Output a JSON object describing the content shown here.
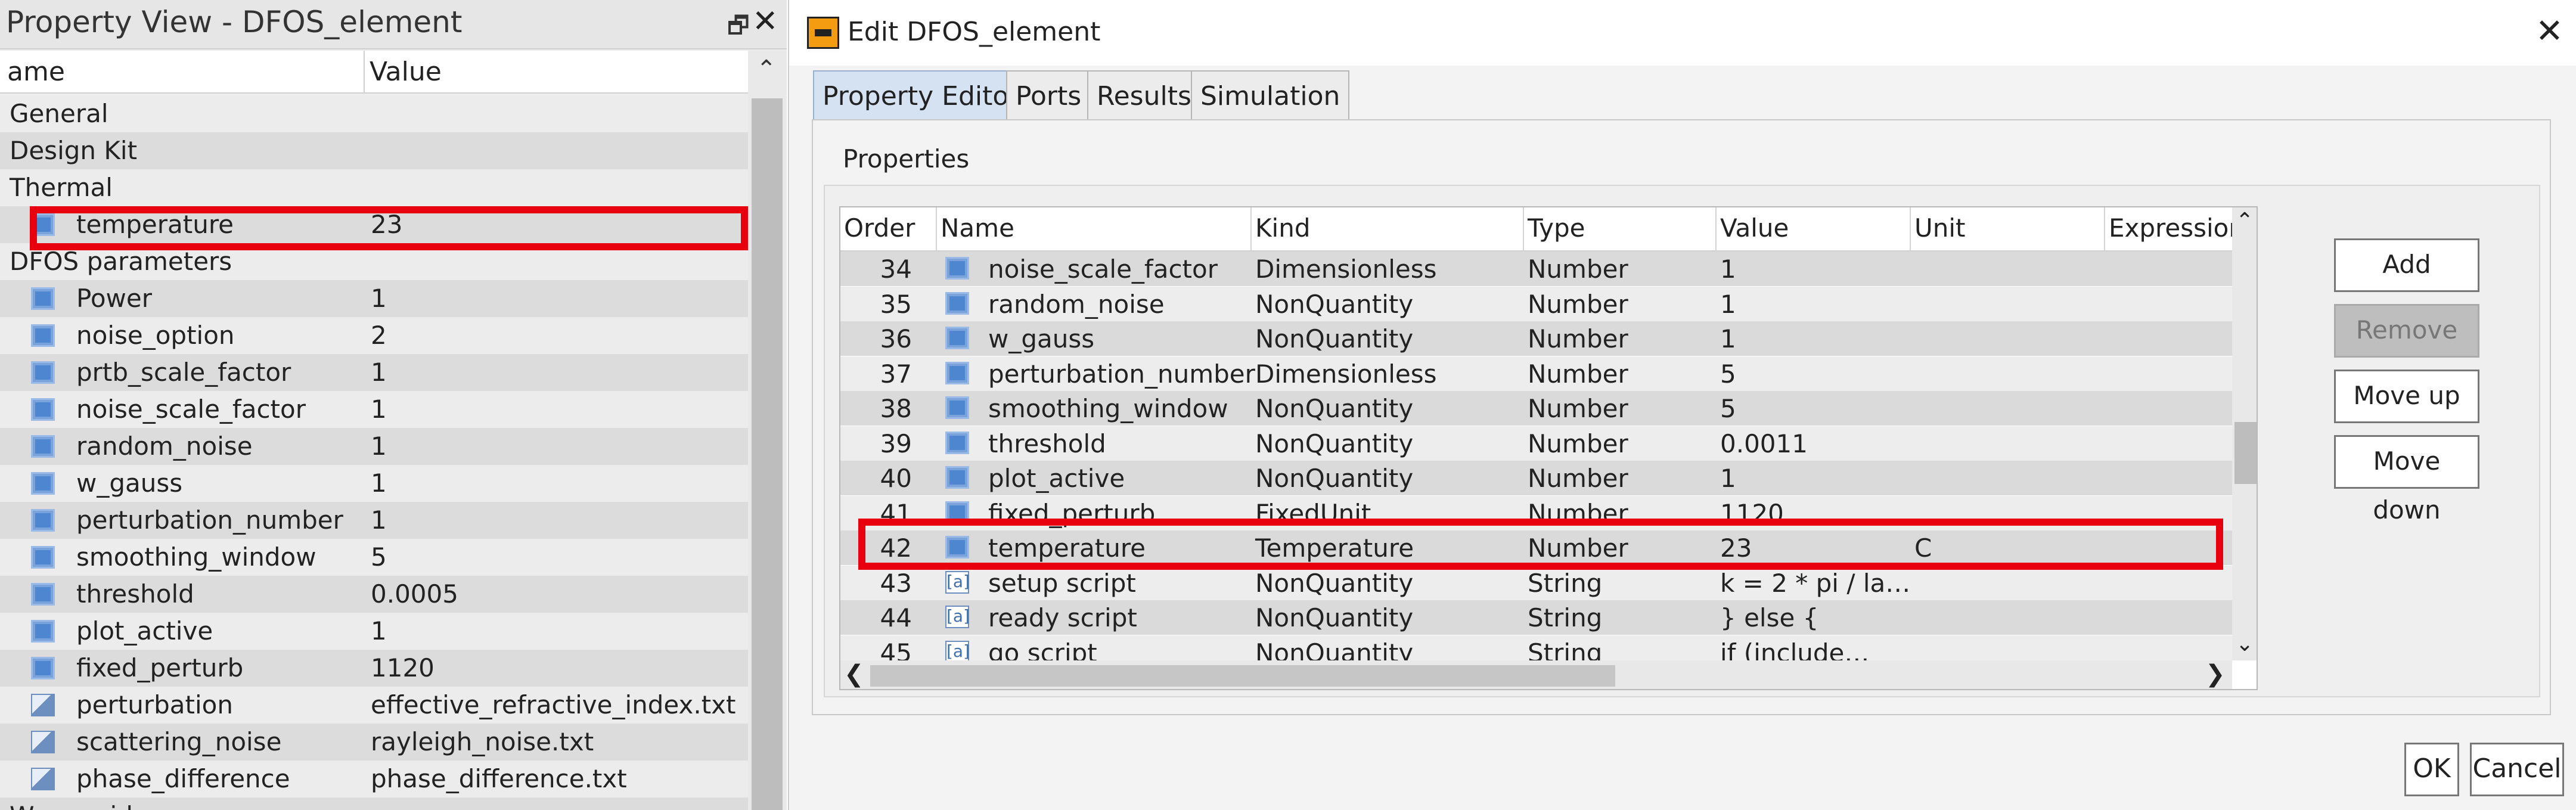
{
  "property_view": {
    "title": "Property View - DFOS_element",
    "restore_glyph": "🗗",
    "close_glyph": "✕",
    "col_name": "ame",
    "col_value": "Value",
    "rows": [
      {
        "name": "General",
        "value": "",
        "kind": "group"
      },
      {
        "name": "Design Kit",
        "value": "",
        "kind": "group"
      },
      {
        "name": "Thermal",
        "value": "",
        "kind": "group"
      },
      {
        "name": "temperature",
        "value": "23",
        "kind": "prop"
      },
      {
        "name": "DFOS parameters",
        "value": "",
        "kind": "group"
      },
      {
        "name": "Power",
        "value": "1",
        "kind": "prop"
      },
      {
        "name": "noise_option",
        "value": "2",
        "kind": "prop"
      },
      {
        "name": "prtb_scale_factor",
        "value": "1",
        "kind": "prop"
      },
      {
        "name": "noise_scale_factor",
        "value": "1",
        "kind": "prop"
      },
      {
        "name": "random_noise",
        "value": "1",
        "kind": "prop"
      },
      {
        "name": "w_gauss",
        "value": "1",
        "kind": "prop"
      },
      {
        "name": "perturbation_number",
        "value": "1",
        "kind": "prop"
      },
      {
        "name": "smoothing_window",
        "value": "5",
        "kind": "prop"
      },
      {
        "name": "threshold",
        "value": "0.0005",
        "kind": "prop"
      },
      {
        "name": "plot_active",
        "value": "1",
        "kind": "prop"
      },
      {
        "name": "fixed_perturb",
        "value": "1120",
        "kind": "prop"
      },
      {
        "name": "perturbation",
        "value": "effective_refractive_index.txt",
        "kind": "file"
      },
      {
        "name": "scattering_noise",
        "value": "rayleigh_noise.txt",
        "kind": "file"
      },
      {
        "name": "phase_difference",
        "value": "phase_difference.txt",
        "kind": "file"
      },
      {
        "name": "Waveguide",
        "value": "",
        "kind": "group"
      }
    ]
  },
  "dialog": {
    "title": "Edit DFOS_element",
    "close_glyph": "✕",
    "tabs": [
      "Property Editor",
      "Ports",
      "Results",
      "Simulation"
    ],
    "active_tab": "Property Editor",
    "section_label": "Properties",
    "columns": [
      "Order",
      "Name",
      "Kind",
      "Type",
      "Value",
      "Unit",
      "Expression"
    ],
    "rows": [
      {
        "order": "34",
        "name": "noise_scale_factor",
        "kind": "Dimensionless",
        "type": "Number",
        "value": "1",
        "unit": "",
        "icon": "number"
      },
      {
        "order": "35",
        "name": "random_noise",
        "kind": "NonQuantity",
        "type": "Number",
        "value": "1",
        "unit": "",
        "icon": "number"
      },
      {
        "order": "36",
        "name": "w_gauss",
        "kind": "NonQuantity",
        "type": "Number",
        "value": "1",
        "unit": "",
        "icon": "number"
      },
      {
        "order": "37",
        "name": "perturbation_number",
        "kind": "Dimensionless",
        "type": "Number",
        "value": "5",
        "unit": "",
        "icon": "number"
      },
      {
        "order": "38",
        "name": "smoothing_window",
        "kind": "NonQuantity",
        "type": "Number",
        "value": "5",
        "unit": "",
        "icon": "number"
      },
      {
        "order": "39",
        "name": "threshold",
        "kind": "NonQuantity",
        "type": "Number",
        "value": "0.0011",
        "unit": "",
        "icon": "number"
      },
      {
        "order": "40",
        "name": "plot_active",
        "kind": "NonQuantity",
        "type": "Number",
        "value": "1",
        "unit": "",
        "icon": "number"
      },
      {
        "order": "41",
        "name": "fixed_perturb",
        "kind": "FixedUnit",
        "type": "Number",
        "value": "1120",
        "unit": "",
        "icon": "number"
      },
      {
        "order": "42",
        "name": "temperature",
        "kind": "Temperature",
        "type": "Number",
        "value": "23",
        "unit": "C",
        "icon": "number"
      },
      {
        "order": "43",
        "name": "setup script",
        "kind": "NonQuantity",
        "type": "String",
        "value": "k = 2 * pi / la…",
        "unit": "",
        "icon": "string"
      },
      {
        "order": "44",
        "name": "ready script",
        "kind": "NonQuantity",
        "type": "String",
        "value": "} else {",
        "unit": "",
        "icon": "string"
      },
      {
        "order": "45",
        "name": "go script",
        "kind": "NonQuantity",
        "type": "String",
        "value": "        if (include…",
        "unit": "",
        "icon": "string"
      }
    ],
    "side_buttons": [
      "Add",
      "Remove",
      "Move up",
      "Move down"
    ],
    "ok_label": "OK",
    "cancel_label": "Cancel",
    "string_icon_text": "[a]",
    "scroll_up": "⌃",
    "scroll_down": "⌄",
    "scroll_left": "❮",
    "scroll_right": "❯"
  },
  "colors": {
    "highlight": "#e8000f",
    "selected_tab": "#d5e2f2",
    "row_alt": "#dadada"
  }
}
